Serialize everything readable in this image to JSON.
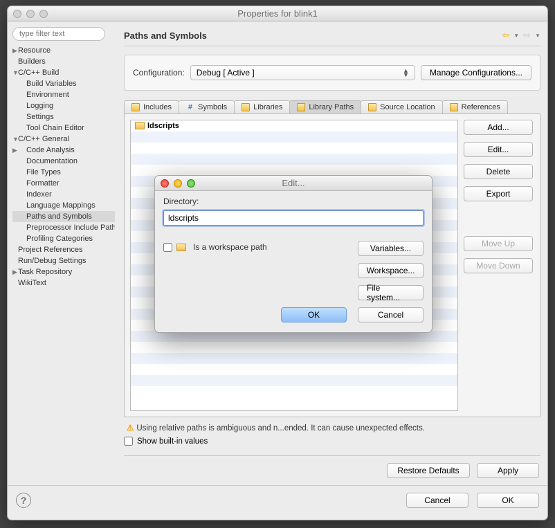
{
  "window": {
    "title": "Properties for blink1"
  },
  "sidebar": {
    "filterPlaceholder": "type filter text",
    "items": [
      {
        "label": "Resource",
        "depth": 0,
        "expander": "▶"
      },
      {
        "label": "Builders",
        "depth": 0,
        "expander": ""
      },
      {
        "label": "C/C++ Build",
        "depth": 0,
        "expander": "▼"
      },
      {
        "label": "Build Variables",
        "depth": 1,
        "expander": ""
      },
      {
        "label": "Environment",
        "depth": 1,
        "expander": ""
      },
      {
        "label": "Logging",
        "depth": 1,
        "expander": ""
      },
      {
        "label": "Settings",
        "depth": 1,
        "expander": ""
      },
      {
        "label": "Tool Chain Editor",
        "depth": 1,
        "expander": ""
      },
      {
        "label": "C/C++ General",
        "depth": 0,
        "expander": "▼"
      },
      {
        "label": "Code Analysis",
        "depth": 1,
        "expander": "▶"
      },
      {
        "label": "Documentation",
        "depth": 1,
        "expander": ""
      },
      {
        "label": "File Types",
        "depth": 1,
        "expander": ""
      },
      {
        "label": "Formatter",
        "depth": 1,
        "expander": ""
      },
      {
        "label": "Indexer",
        "depth": 1,
        "expander": ""
      },
      {
        "label": "Language Mappings",
        "depth": 1,
        "expander": ""
      },
      {
        "label": "Paths and Symbols",
        "depth": 1,
        "expander": "",
        "selected": true
      },
      {
        "label": "Preprocessor Include Paths",
        "depth": 1,
        "expander": ""
      },
      {
        "label": "Profiling Categories",
        "depth": 1,
        "expander": ""
      },
      {
        "label": "Project References",
        "depth": 0,
        "expander": ""
      },
      {
        "label": "Run/Debug Settings",
        "depth": 0,
        "expander": ""
      },
      {
        "label": "Task Repository",
        "depth": 0,
        "expander": "▶"
      },
      {
        "label": "WikiText",
        "depth": 0,
        "expander": ""
      }
    ]
  },
  "main": {
    "title": "Paths and Symbols",
    "config": {
      "label": "Configuration:",
      "value": "Debug  [ Active ]",
      "manage": "Manage Configurations..."
    },
    "tabs": [
      {
        "label": "Includes"
      },
      {
        "label": "Symbols"
      },
      {
        "label": "Libraries"
      },
      {
        "label": "Library Paths",
        "active": true
      },
      {
        "label": "Source Location"
      },
      {
        "label": "References"
      }
    ],
    "list": {
      "items": [
        "ldscripts"
      ]
    },
    "sideButtons": {
      "add": "Add...",
      "edit": "Edit...",
      "delete": "Delete",
      "export": "Export",
      "moveUp": "Move Up",
      "moveDown": "Move Down"
    },
    "note": "Using relative paths is ambiguous and n...ended. It can cause unexpected effects.",
    "showBuiltin": "Show built-in values",
    "restore": "Restore Defaults",
    "apply": "Apply"
  },
  "footer": {
    "cancel": "Cancel",
    "ok": "OK"
  },
  "modal": {
    "title": "Edit...",
    "dirLabel": "Directory:",
    "dirValue": "ldscripts",
    "workspacePath": "Is a workspace path",
    "variables": "Variables...",
    "workspace": "Workspace...",
    "filesystem": "File system...",
    "ok": "OK",
    "cancel": "Cancel"
  }
}
